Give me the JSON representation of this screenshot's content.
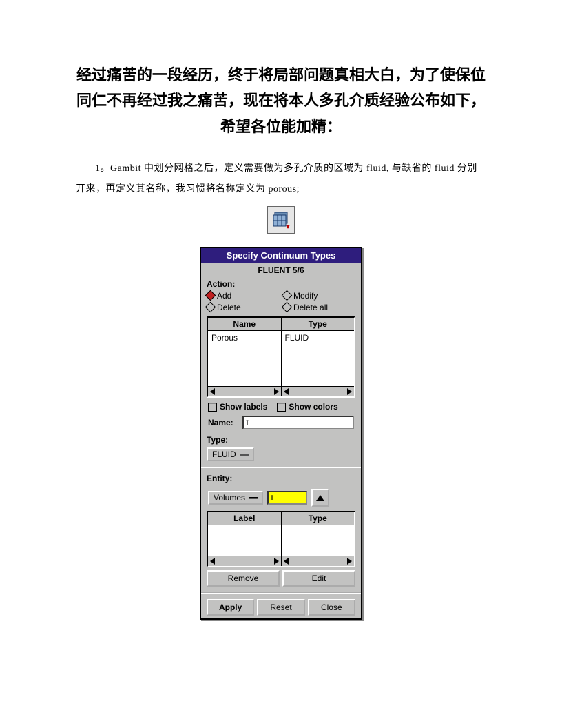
{
  "doc": {
    "title": "经过痛苦的一段经历，终于将局部问题真相大白，为了使保位同仁不再经过我之痛苦，现在将本人多孔介质经验公布如下，希望各位能加精：",
    "paragraph": "1。Gambit 中划分网格之后，定义需要做为多孔介质的区域为 fluid, 与缺省的 fluid 分别开来，再定义其名称，我习惯将名称定义为 porous;"
  },
  "dialog": {
    "title": "Specify Continuum Types",
    "subtitle": "FLUENT 5/6",
    "action_label": "Action:",
    "radios": {
      "add": "Add",
      "modify": "Modify",
      "delete": "Delete",
      "delete_all": "Delete all"
    },
    "list1": {
      "headers": [
        "Name",
        "Type"
      ],
      "row": {
        "name": "Porous",
        "type": "FLUID"
      }
    },
    "checks": {
      "labels": "Show labels",
      "colors": "Show colors"
    },
    "name_label": "Name:",
    "name_value": "",
    "type_label": "Type:",
    "type_value": "FLUID",
    "entity_label": "Entity:",
    "entity_combo": "Volumes",
    "list2": {
      "headers": [
        "Label",
        "Type"
      ]
    },
    "buttons": {
      "remove": "Remove",
      "edit": "Edit",
      "apply": "Apply",
      "reset": "Reset",
      "close": "Close"
    }
  }
}
